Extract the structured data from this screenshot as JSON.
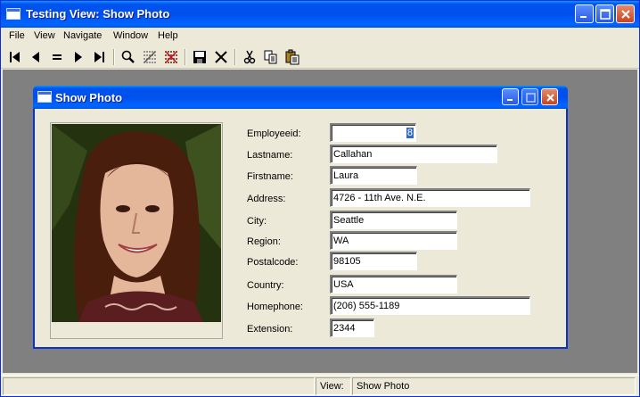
{
  "window": {
    "title": "Testing View: Show Photo"
  },
  "menu": [
    "File",
    "View",
    "Navigate",
    "Window",
    "Help"
  ],
  "toolbar": {
    "icons": [
      "first-record-icon",
      "previous-record-icon",
      "equals-icon",
      "next-record-icon",
      "last-record-icon",
      "search-icon",
      "filter-icon",
      "clear-filter-icon",
      "save-icon",
      "delete-icon",
      "cut-icon",
      "copy-icon",
      "paste-icon"
    ]
  },
  "child": {
    "title": "Show Photo",
    "fields": [
      {
        "label": "Employeeid:",
        "value": "8"
      },
      {
        "label": "Lastname:",
        "value": "Callahan"
      },
      {
        "label": "Firstname:",
        "value": "Laura"
      },
      {
        "label": "Address:",
        "value": "4726 - 11th Ave. N.E."
      },
      {
        "label": "City:",
        "value": "Seattle"
      },
      {
        "label": "Region:",
        "value": "WA"
      },
      {
        "label": "Postalcode:",
        "value": "98105"
      },
      {
        "label": "Country:",
        "value": "USA"
      },
      {
        "label": "Homephone:",
        "value": "(206) 555-1189"
      },
      {
        "label": "Extension:",
        "value": "2344"
      }
    ]
  },
  "status": {
    "label": "View:",
    "value": "Show Photo"
  },
  "colors": {
    "titlebar": "#0053ee",
    "close": "#c8441e",
    "face": "#ece9d8"
  }
}
